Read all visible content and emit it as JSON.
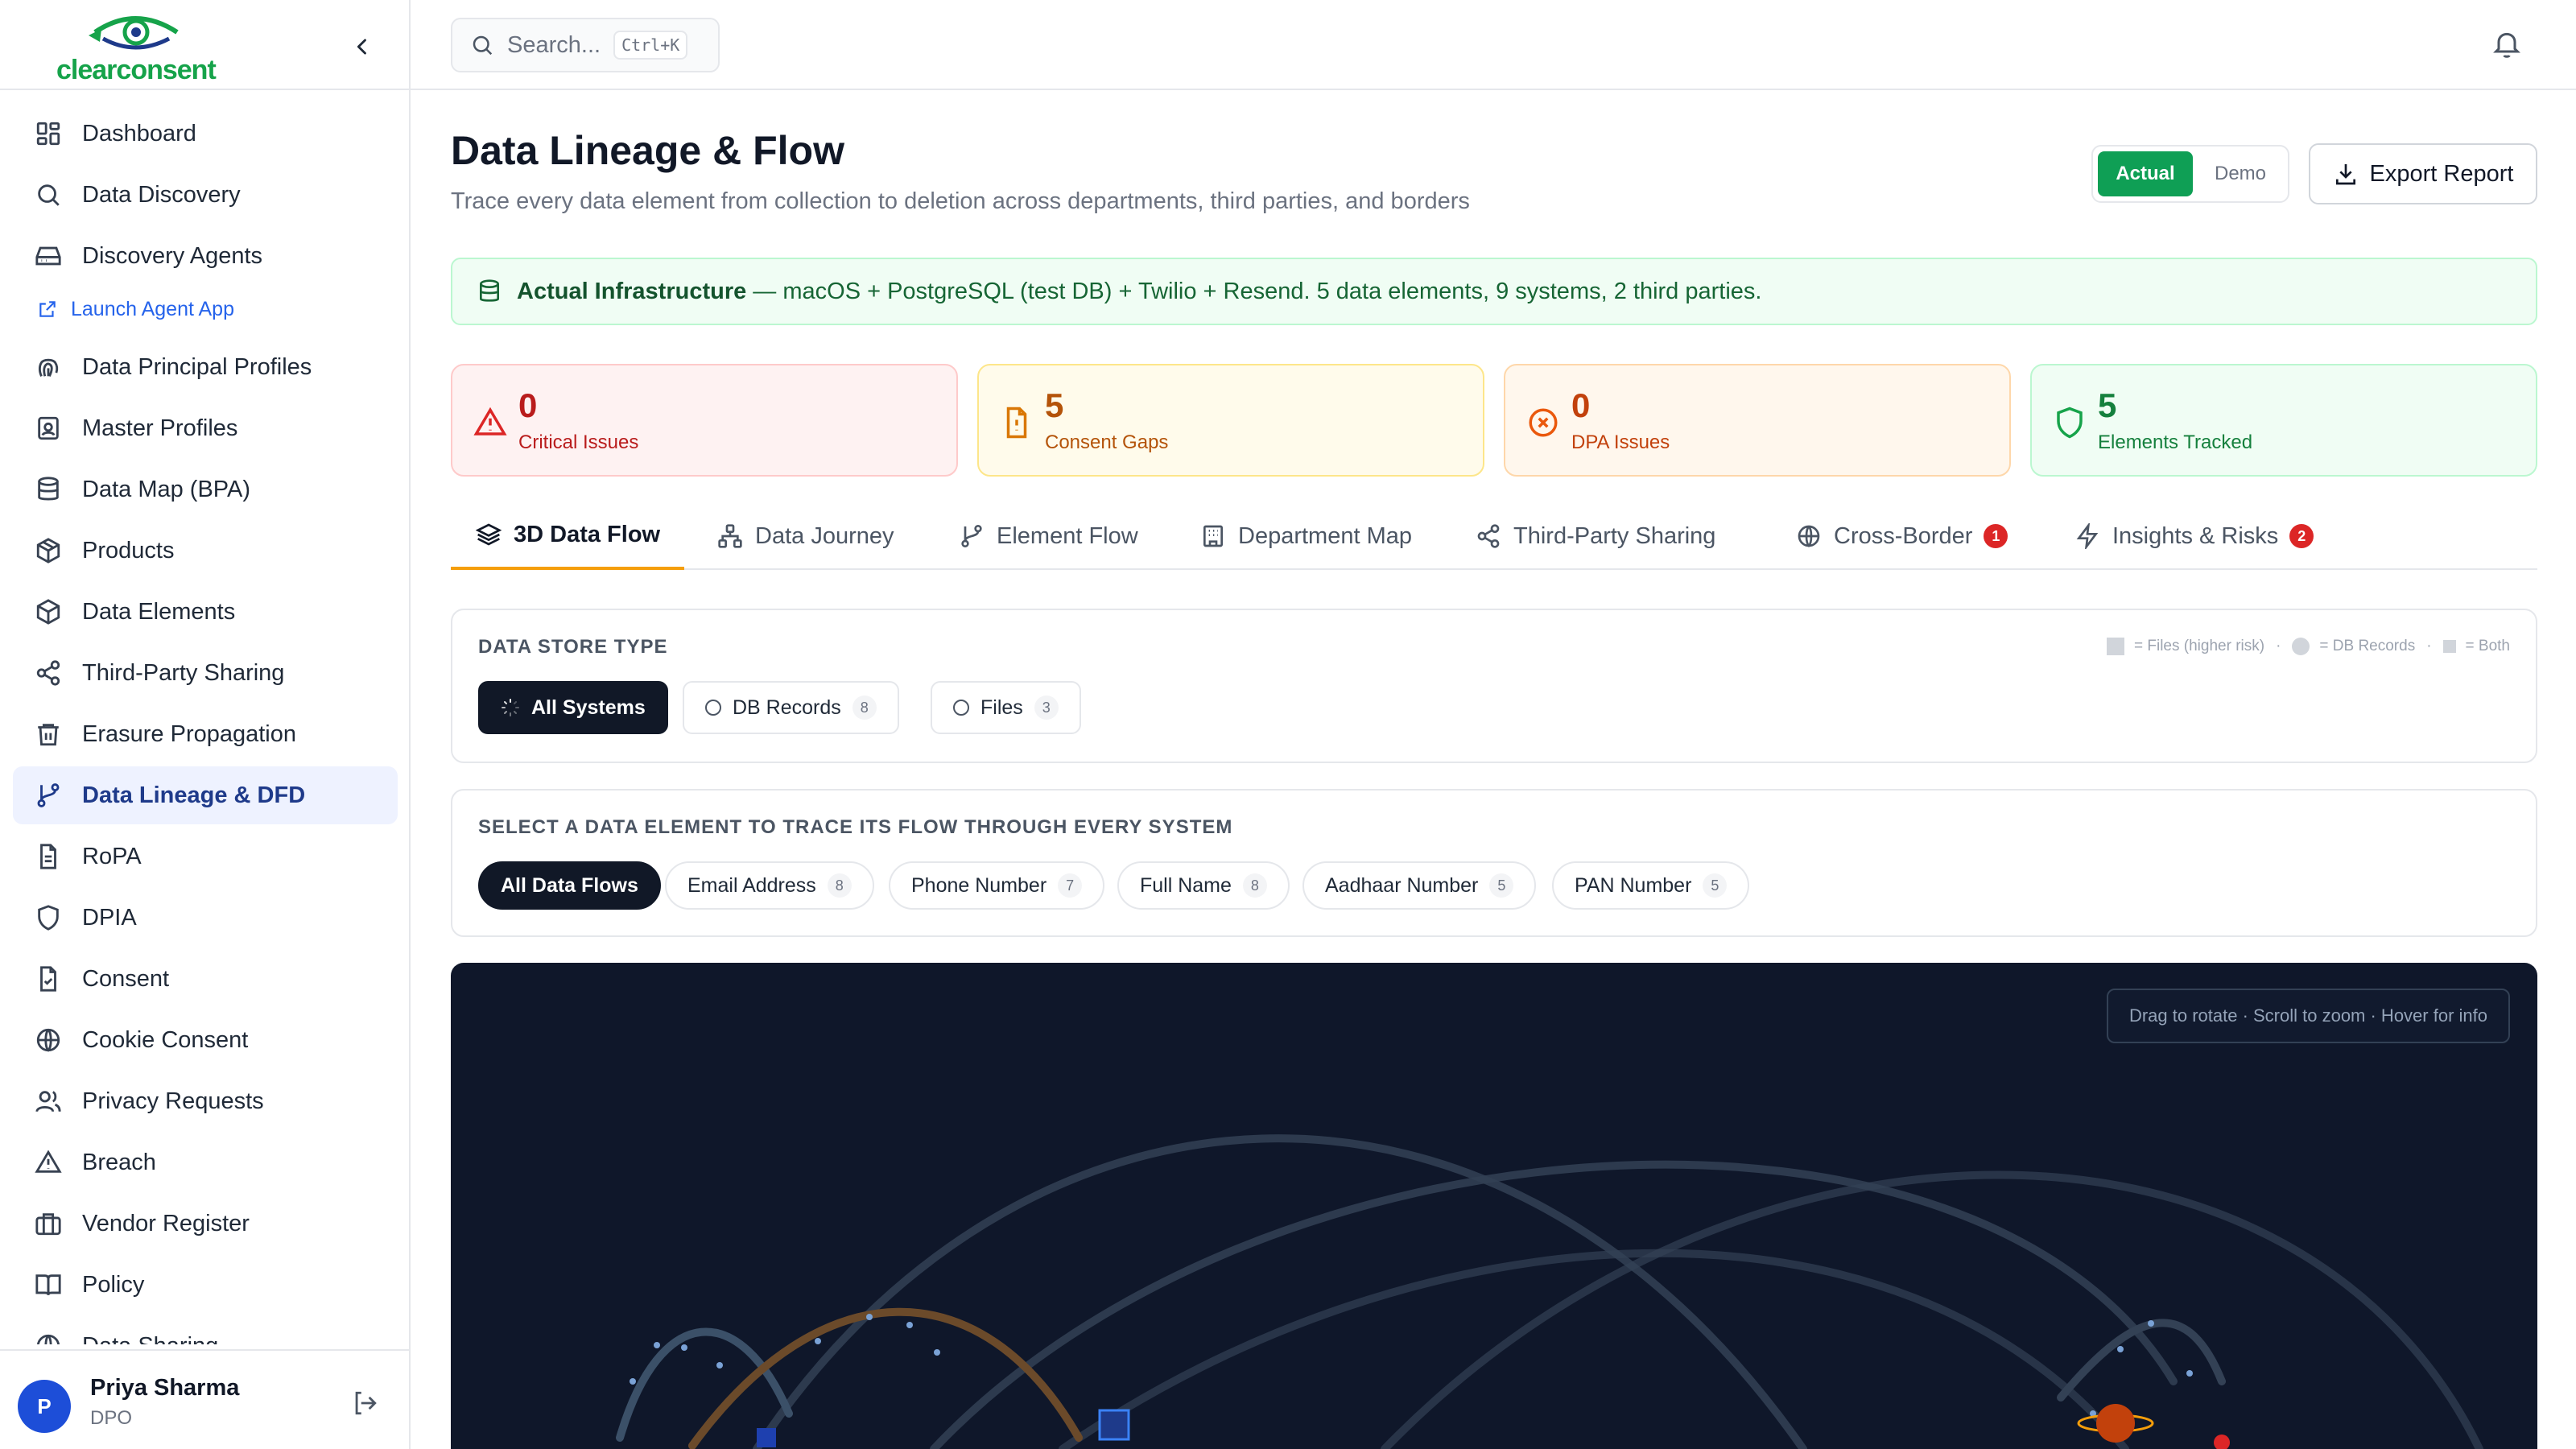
{
  "app": {
    "logo": "clearconsent"
  },
  "search": {
    "placeholder": "Search...",
    "shortcut": "Ctrl+K"
  },
  "sidebar": {
    "items": [
      {
        "label": "Dashboard",
        "icon": "layout-grid-icon"
      },
      {
        "label": "Data Discovery",
        "icon": "search-icon"
      },
      {
        "label": "Discovery Agents",
        "icon": "hard-drive-icon"
      },
      {
        "label": "Data Principal Profiles",
        "icon": "fingerprint-icon"
      },
      {
        "label": "Master Profiles",
        "icon": "contact-icon"
      },
      {
        "label": "Data Map (BPA)",
        "icon": "database-icon"
      },
      {
        "label": "Products",
        "icon": "package-icon"
      },
      {
        "label": "Data Elements",
        "icon": "box-icon"
      },
      {
        "label": "Third-Party Sharing",
        "icon": "share-icon"
      },
      {
        "label": "Erasure Propagation",
        "icon": "trash-icon"
      },
      {
        "label": "Data Lineage & DFD",
        "icon": "git-branch-icon"
      },
      {
        "label": "RoPA",
        "icon": "file-text-icon"
      },
      {
        "label": "DPIA",
        "icon": "shield-icon"
      },
      {
        "label": "Consent",
        "icon": "file-check-icon"
      },
      {
        "label": "Cookie Consent",
        "icon": "globe-icon"
      },
      {
        "label": "Privacy Requests",
        "icon": "users-icon"
      },
      {
        "label": "Breach",
        "icon": "alert-triangle-icon"
      },
      {
        "label": "Vendor Register",
        "icon": "briefcase-icon"
      },
      {
        "label": "Policy",
        "icon": "book-open-icon"
      },
      {
        "label": "Data Sharing",
        "icon": "globe-icon"
      }
    ],
    "sub_link": "Launch Agent App",
    "active": "Data Lineage & DFD"
  },
  "user": {
    "initial": "P",
    "name": "Priya Sharma",
    "role": "DPO"
  },
  "header": {
    "title": "Data Lineage & Flow",
    "subtitle": "Trace every data element from collection to deletion across departments, third parties, and borders",
    "toggle": {
      "on": "Actual",
      "off": "Demo"
    },
    "export_label": "Export Report"
  },
  "infra": {
    "label": "Actual Infrastructure",
    "text": " — macOS + PostgreSQL (test DB) + Twilio + Resend. 5 data elements, 9 systems, 2 third parties."
  },
  "stats": [
    {
      "value": "0",
      "label": "Critical Issues",
      "color": "#b91c1c"
    },
    {
      "value": "5",
      "label": "Consent Gaps",
      "color": "#b45309"
    },
    {
      "value": "0",
      "label": "DPA Issues",
      "color": "#c2410c"
    },
    {
      "value": "5",
      "label": "Elements Tracked",
      "color": "#15803d"
    }
  ],
  "tabs": [
    {
      "label": "3D Data Flow",
      "icon": "layers-icon",
      "active": true
    },
    {
      "label": "Data Journey",
      "icon": "network-icon"
    },
    {
      "label": "Element Flow",
      "icon": "git-branch-icon"
    },
    {
      "label": "Department Map",
      "icon": "building-icon"
    },
    {
      "label": "Third-Party Sharing",
      "icon": "share-icon"
    },
    {
      "label": "Cross-Border",
      "icon": "globe-icon",
      "badge": "1"
    },
    {
      "label": "Insights & Risks",
      "icon": "zap-icon",
      "badge": "2"
    }
  ],
  "store_type": {
    "title": "DATA STORE TYPE",
    "legend": {
      "files": "= Files (higher risk)",
      "db": "= DB Records",
      "both": "= Both"
    },
    "options": [
      {
        "label": "All Systems"
      },
      {
        "label": "DB Records",
        "count": "8"
      },
      {
        "label": "Files",
        "count": "3"
      }
    ]
  },
  "element_select": {
    "title": "SELECT A DATA ELEMENT TO TRACE ITS FLOW THROUGH EVERY SYSTEM",
    "options": [
      {
        "label": "All Data Flows"
      },
      {
        "label": "Email Address",
        "count": "8"
      },
      {
        "label": "Phone Number",
        "count": "7"
      },
      {
        "label": "Full Name",
        "count": "8"
      },
      {
        "label": "Aadhaar Number",
        "count": "5"
      },
      {
        "label": "PAN Number",
        "count": "5"
      }
    ]
  },
  "viz": {
    "hint": "Drag to rotate · Scroll to zoom · Hover for info",
    "background": "#0f172a"
  }
}
